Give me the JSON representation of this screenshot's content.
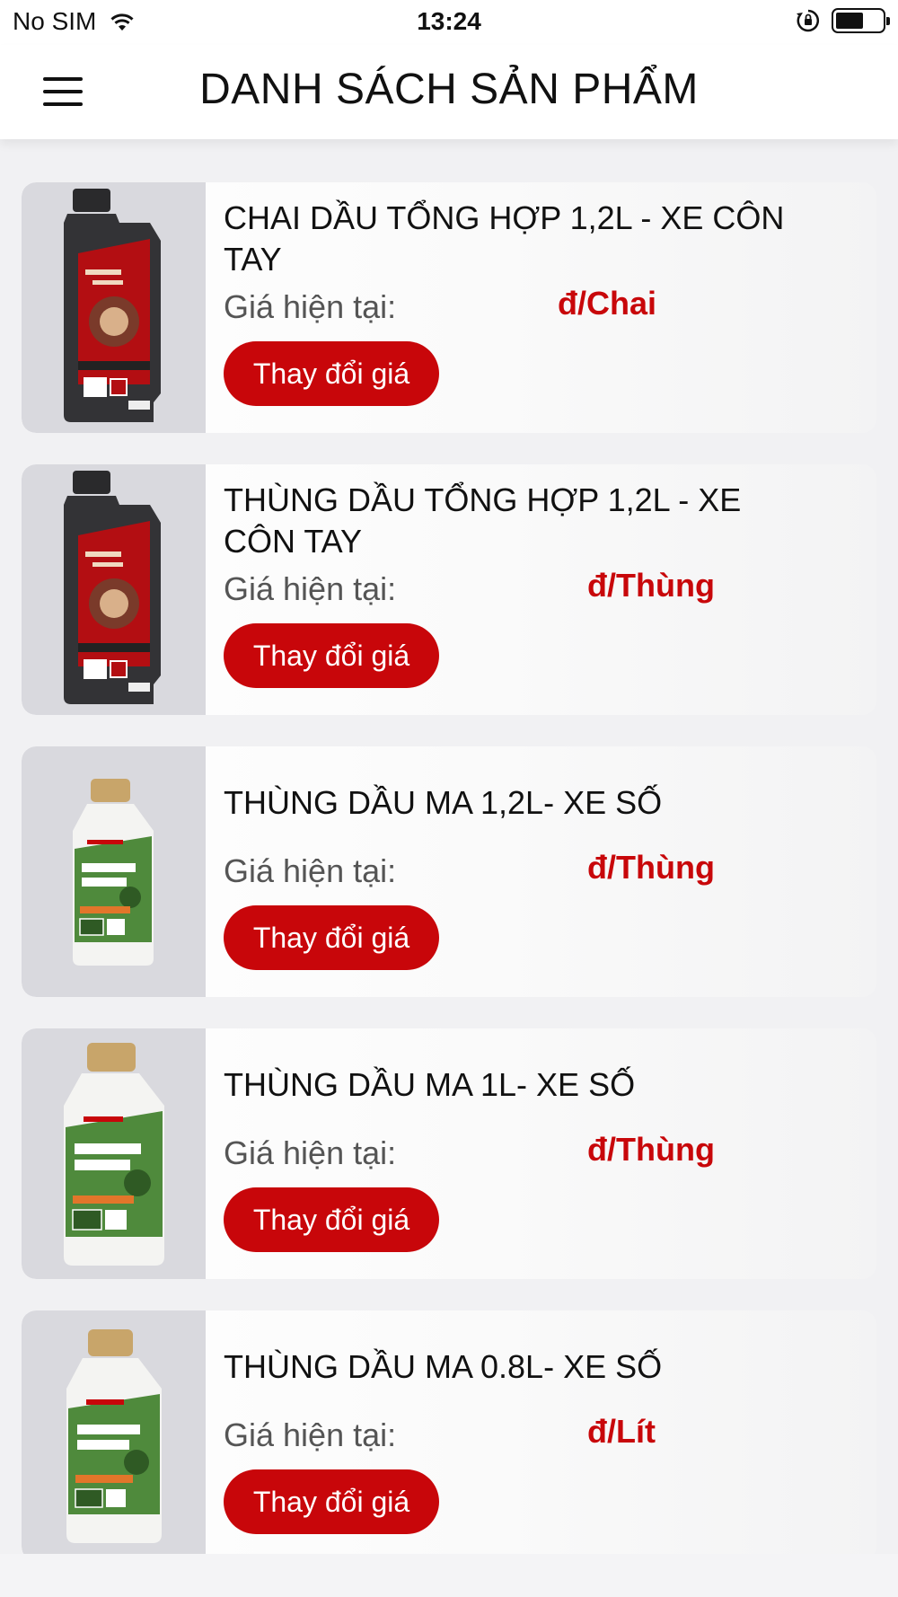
{
  "status_bar": {
    "carrier": "No SIM",
    "time": "13:24"
  },
  "header": {
    "title": "DANH SÁCH SẢN PHẨM"
  },
  "products": [
    {
      "name": "CHAI DẦU TỔNG HỢP 1,2L - XE CÔN TAY",
      "price_label": "Giá hiện tại:",
      "price_value": "đ/Chai",
      "button_label": "Thay đổi giá"
    },
    {
      "name": "THÙNG DẦU TỔNG HỢP 1,2L - XE CÔN TAY",
      "price_label": "Giá hiện tại:",
      "price_value": "đ/Thùng",
      "button_label": "Thay đổi giá"
    },
    {
      "name": "THÙNG DẦU MA 1,2L- XE SỐ",
      "price_label": "Giá hiện tại:",
      "price_value": "đ/Thùng",
      "button_label": "Thay đổi giá"
    },
    {
      "name": "THÙNG DẦU MA 1L- XE SỐ",
      "price_label": "Giá hiện tại:",
      "price_value": "đ/Thùng",
      "button_label": "Thay đổi giá"
    },
    {
      "name": "THÙNG DẦU MA 0.8L- XE SỐ",
      "price_label": "Giá hiện tại:",
      "price_value": "đ/Lít",
      "button_label": "Thay đổi giá"
    }
  ],
  "colors": {
    "accent": "#c8060a",
    "price_text": "#c8070a",
    "card_bg": "#ffffff",
    "thumb_bg": "#d9d9de"
  },
  "icons": {
    "menu": "hamburger-icon",
    "wifi": "wifi-icon",
    "orientation_lock": "orientation-lock-icon",
    "battery": "battery-icon",
    "bottle_synthetic": "black-oil-bottle-icon",
    "bottle_ma": "white-green-oil-bottle-icon"
  }
}
